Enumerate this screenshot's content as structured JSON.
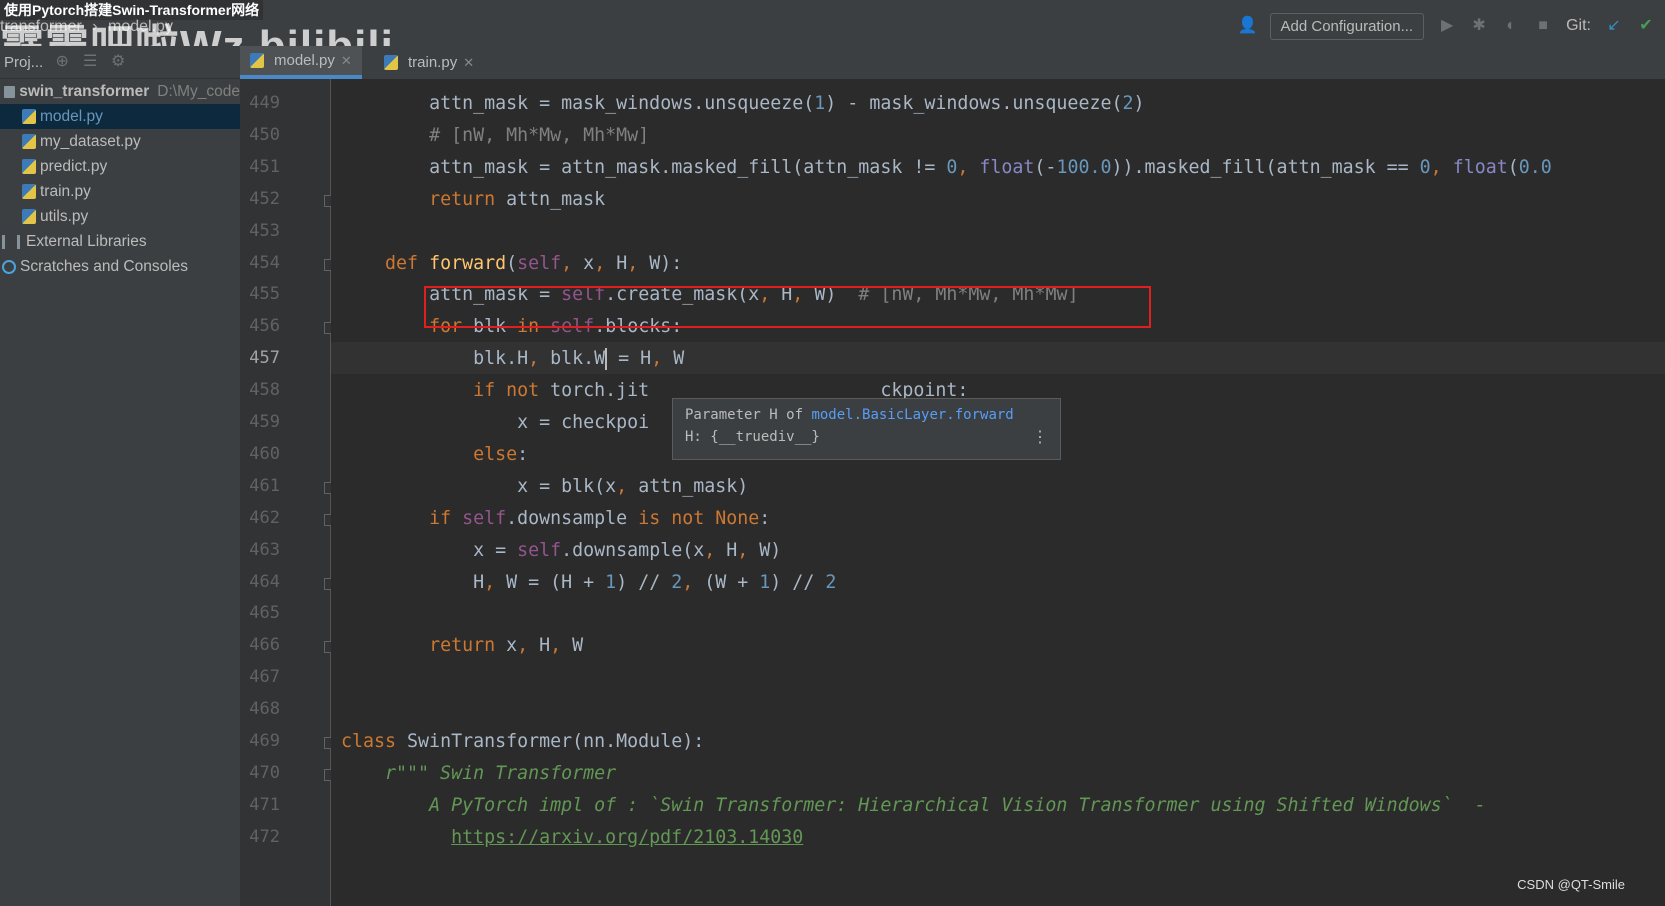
{
  "window": {
    "video_title": "使用Pytorch搭建Swin-Transformer网络",
    "watermark": "霹雳吧啦Wz bilibili",
    "breadcrumbs": [
      "transformer",
      "model.py"
    ],
    "add_configuration": "Add Configuration...",
    "git_label": "Git:"
  },
  "sidebar": {
    "header": "Proj...",
    "root": {
      "label": "swin_transformer",
      "path": "D:\\My_code"
    },
    "files": [
      "model.py",
      "my_dataset.py",
      "predict.py",
      "train.py",
      "utils.py"
    ],
    "selected_index": 0,
    "external_libraries": "External Libraries",
    "scratches": "Scratches and Consoles"
  },
  "tabs": [
    {
      "label": "model.py",
      "active": true
    },
    {
      "label": "train.py",
      "active": false
    }
  ],
  "editor": {
    "current_line": 457,
    "lines": [
      {
        "n": 449,
        "indent": 8,
        "tokens": [
          [
            "",
            "attn_mask = mask_windows.unsqueeze("
          ],
          [
            "num",
            "1"
          ],
          [
            "",
            ") - mask_windows.unsqueeze("
          ],
          [
            "num",
            "2"
          ],
          [
            "",
            ")"
          ]
        ]
      },
      {
        "n": 450,
        "indent": 8,
        "tokens": [
          [
            "cmt",
            "# [nW, Mh*Mw, Mh*Mw]"
          ]
        ]
      },
      {
        "n": 451,
        "indent": 8,
        "tokens": [
          [
            "",
            "attn_mask = attn_mask.masked_fill(attn_mask != "
          ],
          [
            "num",
            "0"
          ],
          [
            "kw",
            ", "
          ],
          [
            "builtin",
            "float"
          ],
          [
            "",
            "(-"
          ],
          [
            "num",
            "100.0"
          ],
          [
            "",
            ")).masked_fill(attn_mask == "
          ],
          [
            "num",
            "0"
          ],
          [
            "kw",
            ", "
          ],
          [
            "builtin",
            "float"
          ],
          [
            "",
            "("
          ],
          [
            "num",
            "0.0"
          ]
        ]
      },
      {
        "n": 452,
        "indent": 8,
        "tokens": [
          [
            "kw",
            "return "
          ],
          [
            "",
            "attn_mask"
          ]
        ]
      },
      {
        "n": 453,
        "indent": 0,
        "tokens": []
      },
      {
        "n": 454,
        "indent": 4,
        "tokens": [
          [
            "kw",
            "def "
          ],
          [
            "fn",
            "forward"
          ],
          [
            "",
            "("
          ],
          [
            "slf",
            "self"
          ],
          [
            "kw",
            ", "
          ],
          [
            "",
            "x"
          ],
          [
            "kw",
            ", "
          ],
          [
            "",
            "H"
          ],
          [
            "kw",
            ", "
          ],
          [
            "",
            "W):"
          ]
        ]
      },
      {
        "n": 455,
        "indent": 8,
        "tokens": [
          [
            "",
            "attn_mask = "
          ],
          [
            "slf",
            "self"
          ],
          [
            "",
            ".create_mask(x"
          ],
          [
            "kw",
            ", "
          ],
          [
            "",
            "H"
          ],
          [
            "kw",
            ", "
          ],
          [
            "",
            "W)  "
          ],
          [
            "cmt",
            "# [nW, Mh*Mw, Mh*Mw]"
          ]
        ]
      },
      {
        "n": 456,
        "indent": 8,
        "tokens": [
          [
            "kw",
            "for "
          ],
          [
            "",
            "blk "
          ],
          [
            "kw",
            "in "
          ],
          [
            "slf",
            "self"
          ],
          [
            "",
            ".blocks:"
          ]
        ]
      },
      {
        "n": 457,
        "indent": 12,
        "tokens": [
          [
            "",
            "blk.H"
          ],
          [
            "kw",
            ", "
          ],
          [
            "",
            "blk.W"
          ],
          [
            "cursor",
            ""
          ],
          [
            "",
            " = H"
          ],
          [
            "kw",
            ", "
          ],
          [
            "",
            "W"
          ]
        ]
      },
      {
        "n": 458,
        "indent": 12,
        "tokens": [
          [
            "kw",
            "if not "
          ],
          [
            "",
            "torch.jit"
          ],
          [
            "pad",
            "                     "
          ],
          [
            "",
            "ckpoint:"
          ]
        ]
      },
      {
        "n": 459,
        "indent": 16,
        "tokens": [
          [
            "",
            "x = checkpoi"
          ]
        ]
      },
      {
        "n": 460,
        "indent": 12,
        "tokens": [
          [
            "kw",
            "else"
          ],
          [
            "",
            ":"
          ]
        ]
      },
      {
        "n": 461,
        "indent": 16,
        "tokens": [
          [
            "",
            "x = blk(x"
          ],
          [
            "kw",
            ", "
          ],
          [
            "",
            "attn_mask)"
          ]
        ]
      },
      {
        "n": 462,
        "indent": 8,
        "tokens": [
          [
            "kw",
            "if "
          ],
          [
            "slf",
            "self"
          ],
          [
            "",
            ".downsample "
          ],
          [
            "kw",
            "is not None"
          ],
          [
            "",
            ":"
          ]
        ]
      },
      {
        "n": 463,
        "indent": 12,
        "tokens": [
          [
            "",
            "x = "
          ],
          [
            "slf",
            "self"
          ],
          [
            "",
            ".downsample(x"
          ],
          [
            "kw",
            ", "
          ],
          [
            "",
            "H"
          ],
          [
            "kw",
            ", "
          ],
          [
            "",
            "W)"
          ]
        ]
      },
      {
        "n": 464,
        "indent": 12,
        "tokens": [
          [
            "",
            "H"
          ],
          [
            "kw",
            ", "
          ],
          [
            "",
            "W = (H + "
          ],
          [
            "num",
            "1"
          ],
          [
            "",
            ") // "
          ],
          [
            "num",
            "2"
          ],
          [
            "kw",
            ", "
          ],
          [
            "",
            "(W + "
          ],
          [
            "num",
            "1"
          ],
          [
            "",
            ") // "
          ],
          [
            "num",
            "2"
          ]
        ]
      },
      {
        "n": 465,
        "indent": 0,
        "tokens": []
      },
      {
        "n": 466,
        "indent": 8,
        "tokens": [
          [
            "kw",
            "return "
          ],
          [
            "",
            "x"
          ],
          [
            "kw",
            ", "
          ],
          [
            "",
            "H"
          ],
          [
            "kw",
            ", "
          ],
          [
            "",
            "W"
          ]
        ]
      },
      {
        "n": 467,
        "indent": 0,
        "tokens": []
      },
      {
        "n": 468,
        "indent": 0,
        "tokens": []
      },
      {
        "n": 469,
        "indent": 0,
        "tokens": [
          [
            "kw",
            "class "
          ],
          [
            "",
            "SwinTransformer(nn.Module):"
          ]
        ]
      },
      {
        "n": 470,
        "indent": 4,
        "tokens": [
          [
            "doc",
            "r\"\"\" Swin Transformer"
          ]
        ]
      },
      {
        "n": 471,
        "indent": 8,
        "tokens": [
          [
            "doc",
            "A PyTorch impl of : `Swin Transformer: Hierarchical Vision Transformer using Shifted Windows`  -"
          ]
        ]
      },
      {
        "n": 472,
        "indent": 10,
        "tokens": [
          [
            "link",
            "https://arxiv.org/pdf/2103.14030"
          ]
        ]
      }
    ]
  },
  "tooltip": {
    "prefix": "Parameter H of ",
    "link": "model.BasicLayer.forward",
    "detail": "H: {__truediv__}",
    "more": "⋮"
  },
  "footer_watermark": "CSDN @QT-Smile"
}
